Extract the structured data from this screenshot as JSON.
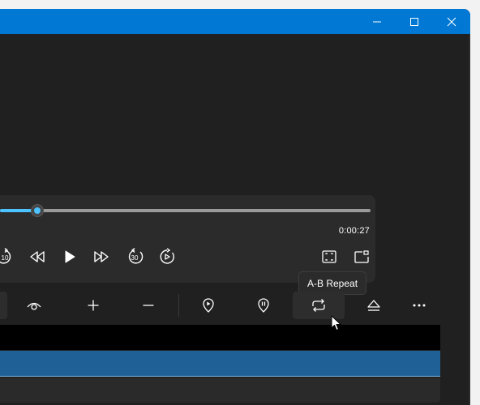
{
  "window": {
    "titlebar_color": "#0078d4",
    "buttons": [
      {
        "name": "minimize-button",
        "icon": "minimize-icon"
      },
      {
        "name": "maximize-button",
        "icon": "maximize-icon"
      },
      {
        "name": "close-button",
        "icon": "close-icon"
      }
    ]
  },
  "player": {
    "accent_color": "#4cc2ff",
    "current_time": "0:00:27",
    "progress_fraction": 0.1,
    "controls": [
      {
        "name": "skip-back-10-button",
        "icon": "skip-back-10-icon",
        "badge": "10"
      },
      {
        "name": "rewind-button",
        "icon": "rewind-icon"
      },
      {
        "name": "play-button",
        "icon": "play-icon"
      },
      {
        "name": "fast-forward-button",
        "icon": "fast-forward-icon"
      },
      {
        "name": "skip-forward-30-button",
        "icon": "skip-forward-30-icon",
        "badge": "30"
      },
      {
        "name": "replay-button",
        "icon": "replay-icon"
      },
      {
        "name": "fullscreen-button",
        "icon": "fullscreen-icon"
      },
      {
        "name": "cast-button",
        "icon": "cast-icon"
      }
    ]
  },
  "tooltip": {
    "text": "A-B Repeat"
  },
  "toolbar": {
    "items": [
      {
        "name": "visibility-button",
        "icon": "eye-icon"
      },
      {
        "name": "zoom-in-button",
        "icon": "plus-icon"
      },
      {
        "name": "zoom-out-button",
        "icon": "minus-icon"
      },
      {
        "name": "set-a-point-button",
        "icon": "location-pin-icon"
      },
      {
        "name": "pause-marker-button",
        "icon": "pause-pin-icon"
      },
      {
        "name": "ab-repeat-button",
        "icon": "repeat-icon",
        "hover": true
      },
      {
        "name": "eject-button",
        "icon": "eject-icon"
      },
      {
        "name": "more-options-button",
        "icon": "more-icon"
      }
    ]
  },
  "list": {
    "selected_color": "#1f6197"
  }
}
